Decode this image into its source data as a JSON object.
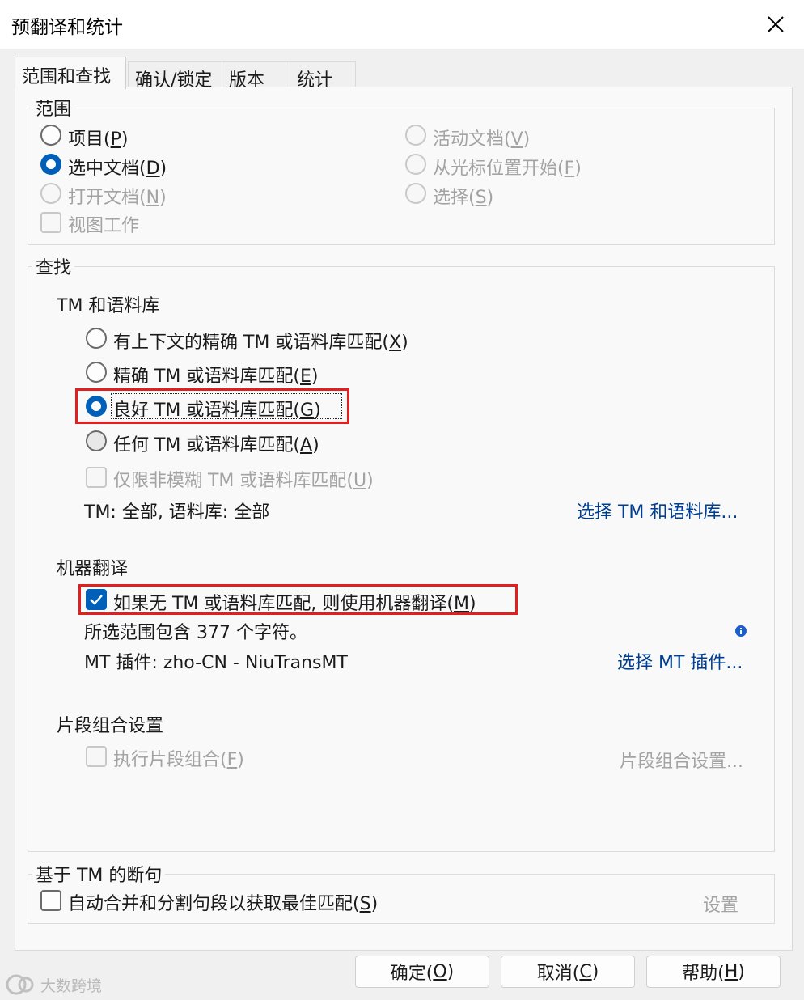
{
  "dialog": {
    "title": "预翻译和统计"
  },
  "tabs": [
    {
      "label": "范围和查找"
    },
    {
      "label": "确认/锁定"
    },
    {
      "label": "版本"
    },
    {
      "label": "统计"
    }
  ],
  "scope": {
    "legend": "范围",
    "project": {
      "text": "项目(",
      "key": "P",
      "end": ")"
    },
    "selected_docs": {
      "text": "选中文档(",
      "key": "D",
      "end": ")"
    },
    "open_docs": {
      "text": "打开文档(",
      "key": "N",
      "end": ")"
    },
    "view_work": "视图工作",
    "active_doc": {
      "text": "活动文档(",
      "key": "V",
      "end": ")"
    },
    "from_cursor": {
      "text": "从光标位置开始(",
      "key": "F",
      "end": ")"
    },
    "selection": {
      "text": "选择(",
      "key": "S",
      "end": ")"
    }
  },
  "find": {
    "legend": "查找",
    "tm_section": "TM 和语料库",
    "opt_context": {
      "text": "有上下文的精确 TM 或语料库匹配(",
      "key": "X",
      "end": ")"
    },
    "opt_exact": {
      "text": "精确 TM 或语料库匹配(",
      "key": "E",
      "end": ")"
    },
    "opt_good": {
      "text": "良好 TM 或语料库匹配(",
      "key": "G",
      "end": ")"
    },
    "opt_any": {
      "text": "任何 TM 或语料库匹配(",
      "key": "A",
      "end": ")"
    },
    "opt_nonfuzzy": {
      "text": "仅限非模糊 TM 或语料库匹配(",
      "key": "U",
      "end": ")"
    },
    "tm_info": "TM: 全部, 语料库: 全部",
    "select_tm_link": "选择 TM 和语料库...",
    "mt_section": "机器翻译",
    "mt_check": {
      "text": "如果无 TM 或语料库匹配, 则使用机器翻译(",
      "key": "M",
      "end": ")"
    },
    "char_count": "所选范围包含 377 个字符。",
    "mt_plugin": "MT 插件: zho-CN - NiuTransMT",
    "select_mt_link": "选择 MT 插件...",
    "segment_section": "片段组合设置",
    "segment_check": {
      "text": "执行片段组合(",
      "key": "F",
      "end": ")"
    },
    "segment_settings_link": "片段组合设置..."
  },
  "segmentation": {
    "legend": "基于 TM 的断句",
    "auto_check": {
      "text": "自动合并和分割句段以获取最佳匹配(",
      "key": "S",
      "end": ")"
    },
    "settings_button": "设置"
  },
  "buttons": {
    "ok": {
      "text": "确定(",
      "key": "O",
      "end": ")"
    },
    "cancel": {
      "text": "取消(",
      "key": "C",
      "end": ")"
    },
    "help": {
      "text": "帮助(",
      "key": "H",
      "end": ")"
    }
  },
  "watermark": "大数跨境",
  "colors": {
    "accent": "#005fb8",
    "link": "#003e92",
    "highlight_box": "#e02020",
    "disabled_text": "#a3a3a3"
  }
}
